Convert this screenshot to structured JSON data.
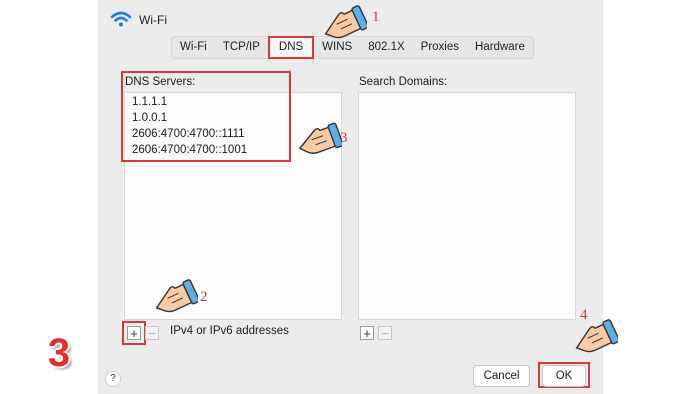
{
  "window": {
    "title": "Wi-Fi"
  },
  "tabs": [
    {
      "label": "Wi-Fi"
    },
    {
      "label": "TCP/IP"
    },
    {
      "label": "DNS",
      "active": true
    },
    {
      "label": "WINS"
    },
    {
      "label": "802.1X"
    },
    {
      "label": "Proxies"
    },
    {
      "label": "Hardware"
    }
  ],
  "dns": {
    "label": "DNS Servers:",
    "servers": [
      "1.1.1.1",
      "1.0.0.1",
      "2606:4700:4700::1111",
      "2606:4700:4700::1001"
    ],
    "hint": "IPv4 or IPv6 addresses"
  },
  "search": {
    "label": "Search Domains:"
  },
  "buttons": {
    "add": "+",
    "remove": "−",
    "help": "?",
    "cancel": "Cancel",
    "ok": "OK"
  },
  "annotations": {
    "badge": "3",
    "steps": [
      "1",
      "2",
      "3",
      "4"
    ]
  },
  "colors": {
    "highlight": "#d9363e",
    "dialog_bg": "#ececec",
    "wifi_icon": "#1f7cf0"
  }
}
